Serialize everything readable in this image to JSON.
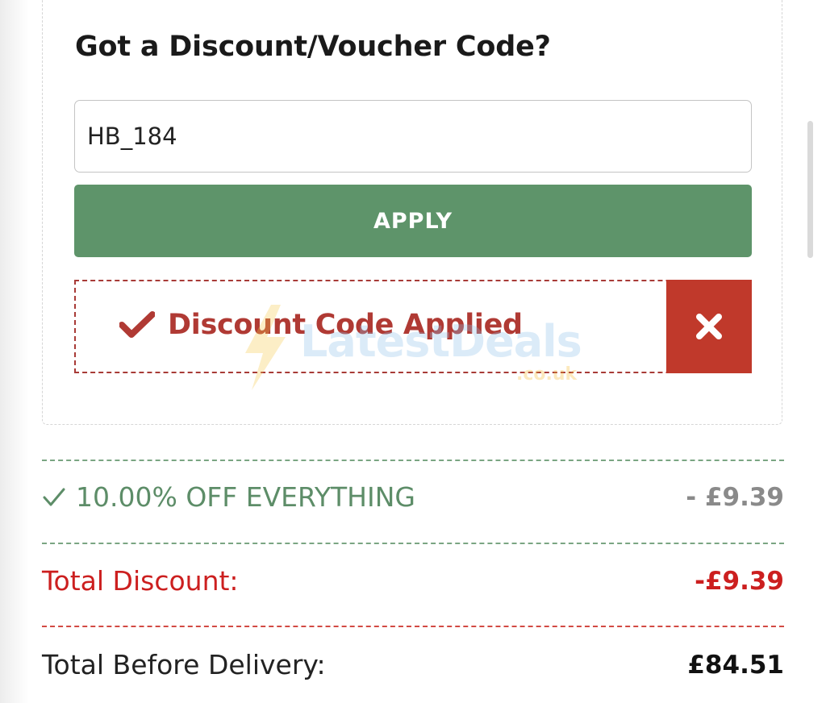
{
  "voucher": {
    "title": "Got a Discount/Voucher Code?",
    "code_value": "HB_184",
    "apply_label": "APPLY",
    "applied_message": "Discount Code Applied"
  },
  "watermark": {
    "main": "LatestDeals",
    "sub": ".co.uk"
  },
  "summary": {
    "offer_label": "10.00% OFF EVERYTHING",
    "offer_amount": "- £9.39",
    "discount_label": "Total Discount:",
    "discount_amount": "-£9.39",
    "total_label": "Total Before Delivery:",
    "total_amount": "£84.51"
  },
  "icons": {
    "applied_check": "check-icon",
    "remove": "close-icon",
    "offer_check": "check-icon"
  },
  "colors": {
    "apply_button": "#5e946a",
    "applied_text": "#b03a34",
    "remove_button": "#c0392b",
    "offer_text": "#5d8d68",
    "discount_text": "#cc1f1f"
  }
}
